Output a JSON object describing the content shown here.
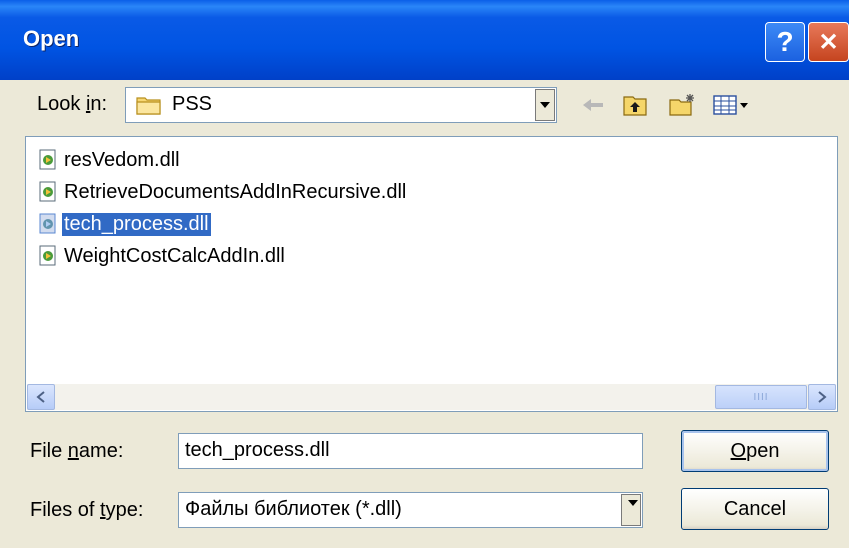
{
  "window": {
    "title": "Open",
    "help_button": "?",
    "close_button": "✕"
  },
  "lookin": {
    "label_pre": "Look ",
    "label_key": "i",
    "label_post": "n:",
    "value": "PSS"
  },
  "toolbar": {
    "icons": [
      "back-arrow-icon",
      "up-one-level-icon",
      "new-folder-icon",
      "view-menu-icon"
    ]
  },
  "files": [
    {
      "name": "resVedom.dll"
    },
    {
      "name": "RetrieveDocumentsAddInRecursive.dll"
    },
    {
      "name": "tech_process.dll",
      "selected": true
    },
    {
      "name": "WeightCostCalcAddIn.dll"
    }
  ],
  "filename": {
    "label_pre": "File ",
    "label_key": "n",
    "label_post": "ame:",
    "value": "tech_process.dll"
  },
  "filetype": {
    "label_pre": "Files of ",
    "label_key": "t",
    "label_post": "ype:",
    "value": "Файлы библиотек (*.dll)"
  },
  "buttons": {
    "open_key": "O",
    "open_rest": "pen",
    "cancel": "Cancel"
  },
  "colors": {
    "titlebar": "#0054e3",
    "selection": "#316ac5",
    "dialog_bg": "#ece9d8"
  }
}
